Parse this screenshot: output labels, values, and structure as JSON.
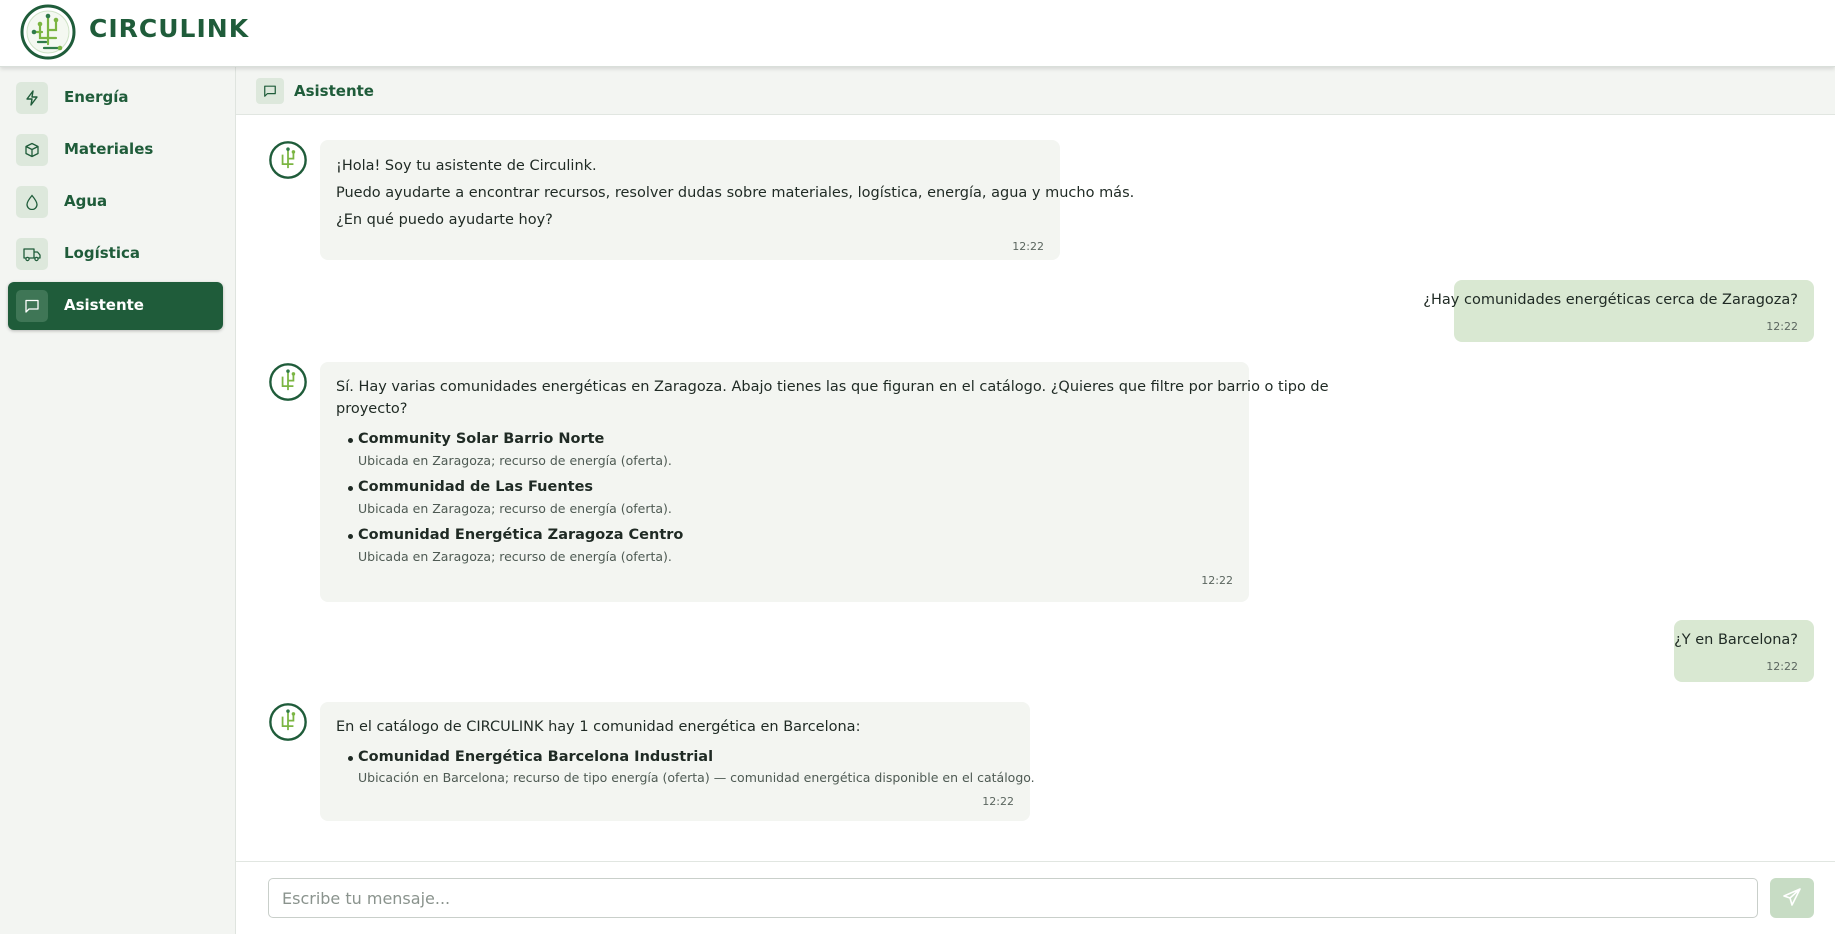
{
  "app": {
    "brand": "CIRCULINK",
    "logo_icon": "circulink-logo"
  },
  "colors": {
    "primary": "#1f5c3a",
    "sidebar_bg": "#f3f5f2",
    "bot_bubble": "#f3f5f1",
    "user_bubble": "#d9e8d2",
    "accent_light": "#dde8dc"
  },
  "sidebar": {
    "items": [
      {
        "label": "Energía",
        "icon": "lightning-icon",
        "active": false
      },
      {
        "label": "Materiales",
        "icon": "box-icon",
        "active": false
      },
      {
        "label": "Agua",
        "icon": "water-drop-icon",
        "active": false
      },
      {
        "label": "Logística",
        "icon": "truck-icon",
        "active": false
      },
      {
        "label": "Asistente",
        "icon": "chat-icon",
        "active": true
      }
    ]
  },
  "chat": {
    "header_title": "Asistente",
    "messages": [
      {
        "role": "assistant",
        "lines": [
          "¡Hola! Soy tu asistente de Circulink.",
          "Puedo ayudarte a encontrar recursos, resolver dudas sobre materiales, logística, energía, agua y mucho más.",
          "¿En qué puedo ayudarte hoy?"
        ],
        "time": "12:22"
      },
      {
        "role": "user",
        "text": "¿Hay comunidades energéticas cerca de Zaragoza?",
        "time": "12:22"
      },
      {
        "role": "assistant",
        "lines": [
          "Sí. Hay varias comunidades energéticas en Zaragoza. Abajo tienes las que figuran en el catálogo. ¿Quieres que filtre por barrio o tipo de",
          "proyecto?"
        ],
        "items": [
          {
            "title": "Community Solar Barrio Norte",
            "desc": "Ubicada en Zaragoza; recurso de energía (oferta)."
          },
          {
            "title": "Communidad de Las Fuentes",
            "desc": "Ubicada en Zaragoza; recurso de energía (oferta)."
          },
          {
            "title": "Comunidad Energética Zaragoza Centro",
            "desc": "Ubicada en Zaragoza; recurso de energía (oferta)."
          }
        ],
        "time": "12:22"
      },
      {
        "role": "user",
        "text": "¿Y en Barcelona?",
        "time": "12:22"
      },
      {
        "role": "assistant",
        "lines": [
          "En el catálogo de CIRCULINK hay 1 comunidad energética en Barcelona:"
        ],
        "items": [
          {
            "title": "Comunidad Energética Barcelona Industrial",
            "desc": "Ubicación en Barcelona; recurso de tipo energía (oferta) — comunidad energética disponible en el catálogo."
          }
        ],
        "time": "12:22"
      }
    ]
  },
  "composer": {
    "placeholder": "Escribe tu mensaje...",
    "value": "",
    "send_icon": "send-icon"
  }
}
